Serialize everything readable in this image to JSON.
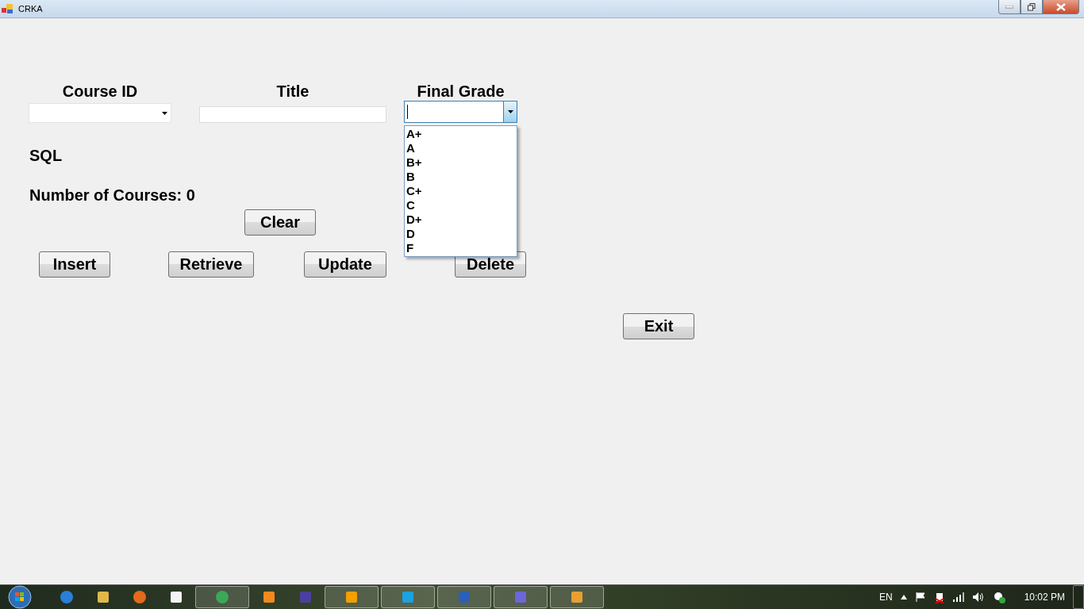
{
  "window": {
    "title": "CRKA"
  },
  "fields": [
    {
      "label": "Course ID",
      "kind": "combo",
      "open": false
    },
    {
      "label": "Title",
      "kind": "text"
    },
    {
      "label": "Final Grade",
      "kind": "combo",
      "open": true,
      "options": [
        "A+",
        "A",
        "B+",
        "B",
        "C+",
        "C",
        "D+",
        "D",
        "F"
      ]
    }
  ],
  "sql_label": "SQL",
  "count_label": "Number of Courses: 0",
  "clear_button": "Clear",
  "action_buttons": [
    "Insert",
    "Retrieve",
    "Update",
    "Delete"
  ],
  "exit_button": "Exit",
  "taskbar": {
    "apps": [
      {
        "running": false
      },
      {
        "running": false
      },
      {
        "running": false
      },
      {
        "running": false
      },
      {
        "running": true
      },
      {
        "running": false
      },
      {
        "running": false
      },
      {
        "running": true
      },
      {
        "running": true
      },
      {
        "running": true
      },
      {
        "running": true
      },
      {
        "running": true
      }
    ],
    "language": "EN",
    "clock": "10:02 PM"
  }
}
